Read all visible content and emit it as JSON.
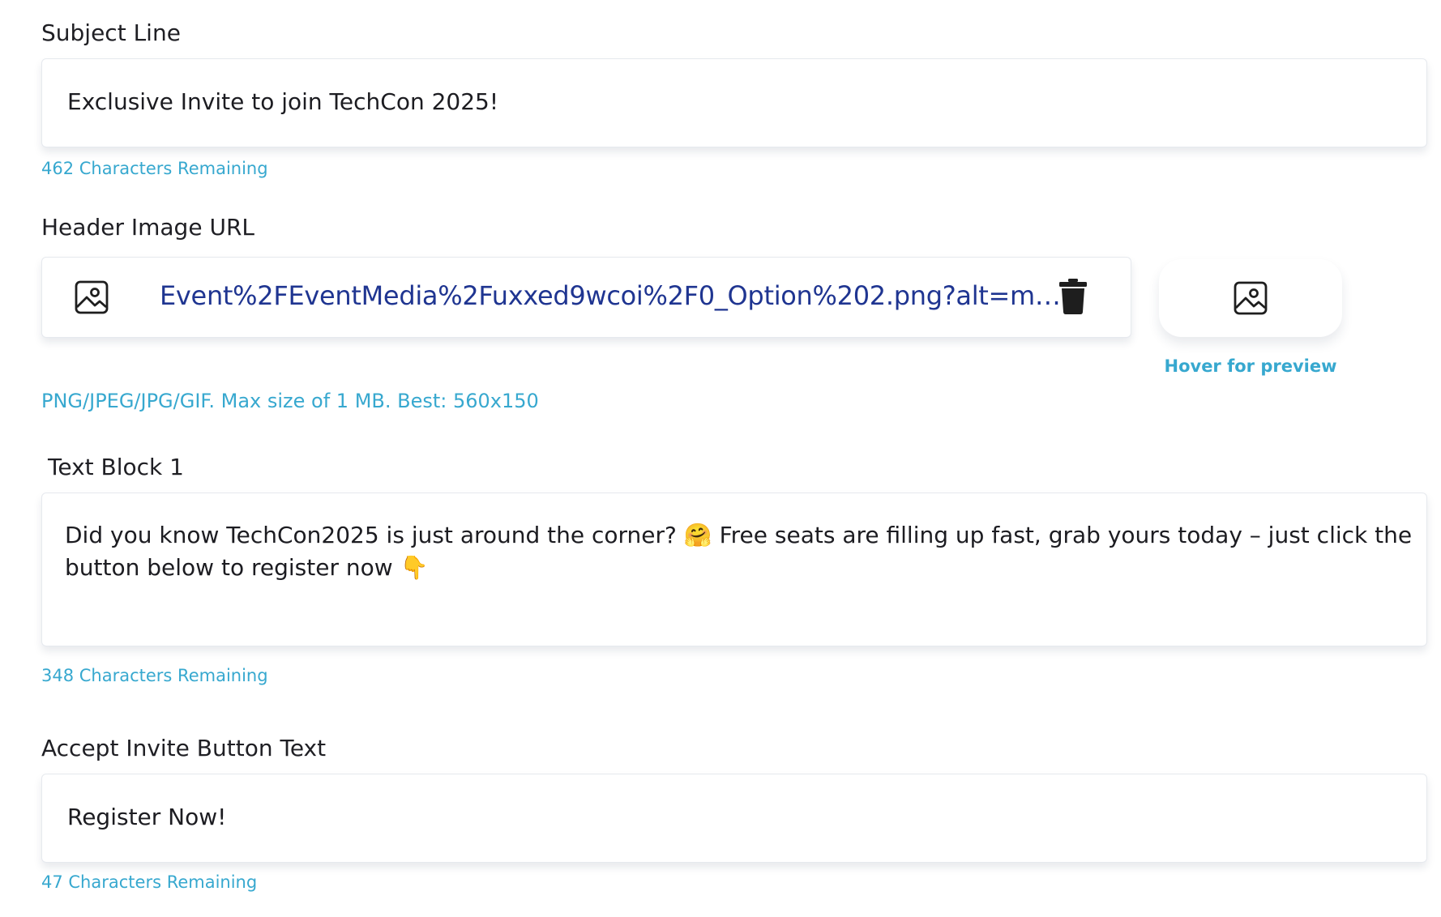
{
  "subject": {
    "label": "Subject Line",
    "value": "Exclusive Invite to join TechCon 2025!",
    "remaining": "462 Characters Remaining"
  },
  "header_image": {
    "label": "Header Image URL",
    "url": "Event%2FEventMedia%2Fuxxed9wcoi%2F0_Option%202.png?alt=me…",
    "formats_hint": "PNG/JPEG/JPG/GIF. Max size of 1 MB. Best: 560x150",
    "preview_hint": "Hover for preview",
    "icons": [
      "image-icon",
      "trash-icon",
      "image-preview-icon"
    ]
  },
  "text_block_1": {
    "label": "Text Block 1",
    "value": "Did you know TechCon2025 is just around the corner? 🤗 Free seats are filling up fast, grab yours today – just click the button below to register now 👇",
    "remaining": "348 Characters Remaining"
  },
  "accept_button": {
    "label": "Accept Invite Button Text",
    "value": "Register Now!",
    "remaining": "47 Characters Remaining"
  },
  "colors": {
    "hint": "#37a8cf",
    "url": "#1f3591",
    "border": "#e6e9ee"
  }
}
